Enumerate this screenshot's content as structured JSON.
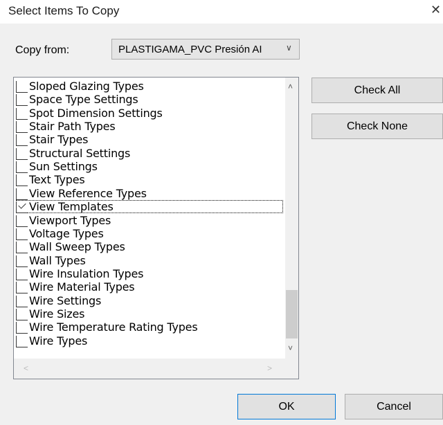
{
  "dialog": {
    "title": "Select Items To Copy",
    "close_glyph": "✕"
  },
  "copy_from": {
    "label": "Copy from:",
    "value": "PLASTIGAMA_PVC Presión AI"
  },
  "list": {
    "items": [
      {
        "label": "Sloped Glazing Types",
        "checked": false
      },
      {
        "label": "Space Type Settings",
        "checked": false
      },
      {
        "label": "Spot Dimension Settings",
        "checked": false
      },
      {
        "label": "Stair Path Types",
        "checked": false
      },
      {
        "label": "Stair Types",
        "checked": false
      },
      {
        "label": "Structural Settings",
        "checked": false
      },
      {
        "label": "Sun Settings",
        "checked": false
      },
      {
        "label": "Text Types",
        "checked": false
      },
      {
        "label": "View Reference Types",
        "checked": false
      },
      {
        "label": "View Templates",
        "checked": true
      },
      {
        "label": "Viewport Types",
        "checked": false
      },
      {
        "label": "Voltage Types",
        "checked": false
      },
      {
        "label": "Wall Sweep Types",
        "checked": false
      },
      {
        "label": "Wall Types",
        "checked": false
      },
      {
        "label": "Wire Insulation Types",
        "checked": false
      },
      {
        "label": "Wire Material Types",
        "checked": false
      },
      {
        "label": "Wire Settings",
        "checked": false
      },
      {
        "label": "Wire Sizes",
        "checked": false
      },
      {
        "label": "Wire Temperature Rating Types",
        "checked": false
      },
      {
        "label": "Wire Types",
        "checked": false
      }
    ],
    "focused_index": 9,
    "scroll_arrows": {
      "up": "˄",
      "down": "˅",
      "left": "<",
      "right": ">"
    }
  },
  "buttons": {
    "check_all": "Check All",
    "check_none": "Check None",
    "ok": "OK",
    "cancel": "Cancel"
  },
  "colors": {
    "accent": "#0078d7",
    "dialog_bg": "#f0f0f0"
  }
}
